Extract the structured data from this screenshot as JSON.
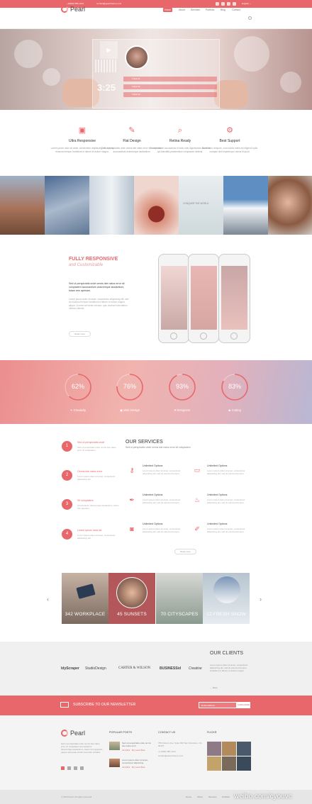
{
  "topbar": {
    "phone": "+1(800) 555-1212",
    "email": "contact@pearl-theme.com",
    "lang": "English ⌄"
  },
  "header": {
    "logo": "Pearl",
    "nav": [
      "Home",
      "About",
      "Services",
      "Portfolio",
      "Blog",
      "Contact"
    ],
    "active": "Home"
  },
  "hero": {
    "time": "3:25",
    "tracks": [
      "Track 01",
      "Track 02",
      "Track 03"
    ]
  },
  "features": [
    {
      "title": "Ultra Responsive",
      "icon": "responsive-icon",
      "text": "Lorem ipsum dolor sit amet, consectetur adipisicing elit, sed do eiusmod tempor incididunt ut labore et dolore magna."
    },
    {
      "title": "Flat Design",
      "icon": "pencil-icon",
      "text": "Sed ut perspiciatis unde omnis iste natus error sit voluptatem accusantium doloremque laudantium."
    },
    {
      "title": "Retina Ready",
      "icon": "magnifier-icon",
      "text": "At vero eos et accusamus et iusto odio dignissimos ducimus qui blanditiis praesentium voluptatum deleniti."
    },
    {
      "title": "Best Support",
      "icon": "gear-icon",
      "text": "Nam libero tempore, cum soluta nobis est eligendi optio cumque nihil impedit quo minus id quod."
    }
  ],
  "strip": {
    "label": "CONQUER THE WORLD"
  },
  "responsive": {
    "title": "FULLY RESPONSIVE",
    "subtitle": "and Customizable",
    "p1": "Sed ut perspiciatis unde omnis iste natus error sit voluptatem accusantium doloremque laudantium, totam rem aperiam.",
    "p2": "Lorem ipsum dolor sit amet, consectetur adipisicing elit, sed do eiusmod tempor incididunt ut labore et dolore magna aliqua. Ut enim ad minim veniam, quis nostrud exercitation ullamco laboris.",
    "button": "Read more"
  },
  "skills": [
    {
      "value": "62%",
      "pct": 62,
      "label": "Creativity",
      "icon": "✦"
    },
    {
      "value": "76%",
      "pct": 76,
      "label": "Web Design",
      "icon": "▣"
    },
    {
      "value": "93%",
      "pct": 93,
      "label": "Designers",
      "icon": "♥"
    },
    {
      "value": "83%",
      "pct": 83,
      "label": "Coding",
      "icon": "◆"
    }
  ],
  "steps": [
    {
      "n": "1",
      "title": "Sed ut perspiciatis unde",
      "text": "Sed ut perspiciatis unde omnis iste natus error sit voluptatem."
    },
    {
      "n": "2",
      "title": "Omnis iste natus error",
      "text": "Lorem ipsum dolor sit amet, consectetur adipisicing elit."
    },
    {
      "n": "3",
      "title": "Sit voluptatem",
      "text": "Accusantium doloremque laudantium, totam rem aperiam."
    },
    {
      "n": "4",
      "title": "Lorem ipsum dolor sit",
      "text": "Lorem ipsum dolor sit amet, consectetur adipisicing elit."
    }
  ],
  "services": {
    "title": "OUR SERVICES",
    "subtitle": "Sed ut perspiciatis unde omnis iste natus error sit voluptatem",
    "items": [
      {
        "title": "Unlimited Options",
        "icon": "key-icon",
        "text": "Lorem ipsum dolor sit amet, consectetur adipisicing elit, sed do eiusmod tempor."
      },
      {
        "title": "Unlimited Options",
        "icon": "browser-icon",
        "text": "Lorem ipsum dolor sit amet, consectetur adipisicing elit, sed do eiusmod tempor."
      },
      {
        "title": "Unlimited Options",
        "icon": "pen-icon",
        "text": "Lorem ipsum dolor sit amet, consectetur adipisicing elit, sed do eiusmod tempor."
      },
      {
        "title": "Unlimited Options",
        "icon": "fire-icon",
        "text": "Lorem ipsum dolor sit amet, consectetur adipisicing elit, sed do eiusmod tempor."
      },
      {
        "title": "Unlimited Options",
        "icon": "camera-icon",
        "text": "Lorem ipsum dolor sit amet, consectetur adipisicing elit, sed do eiusmod tempor."
      },
      {
        "title": "Unlimited Options",
        "icon": "clip-icon",
        "text": "Lorem ipsum dolor sit amet, consectetur adipisicing elit, sed do eiusmod tempor."
      }
    ],
    "button": "Read more"
  },
  "portfolio": [
    {
      "label": "342 WORKPLACE"
    },
    {
      "label": "45 SUNSETS"
    },
    {
      "label": "70 CITYSCAPES"
    },
    {
      "label": "12 FRESH SNOW"
    }
  ],
  "clients": {
    "title": "OUR CLIENTS",
    "text": "Lorem ipsum dolor sit amet, consectetur adipisicing elit, sed do eiusmod tempor incididunt ut labore et dolore magna.",
    "more": "→ More",
    "logos": [
      "IdyScraper",
      "StudioDesign",
      "CARTER & WILSON",
      "BUSINESSid",
      "Creative"
    ]
  },
  "newsletter": {
    "label": "SUBSCRIBE TO OUR NEWSLETTER",
    "placeholder": "Email address",
    "button": "SUBSCRIBE"
  },
  "footer": {
    "logo": "Pearl",
    "about": "Sed ut perspiciatis unde omnis iste natus error sit voluptatem accusantium doloremque laudantium, totam rem aperiam, eaque ipsa quae ab illo inventore veritatis.",
    "popular_title": "POPULAR POSTS",
    "posts": [
      {
        "title": "Sed ut perspiciatis unde omnis iste natus error",
        "meta": "Jul 2014 · By Laura Bow"
      },
      {
        "title": "Lorem ipsum dolor sit amet, consectetur adipisicing",
        "meta": "Jul 2014 · By Laura Bow"
      }
    ],
    "contact_title": "CONTACT US",
    "contact": [
      "795 Folsom Ave, Suite 600 San Francisco, CA 94107",
      "+1 (800) 555-1212",
      "contact@pearl-theme.com"
    ],
    "flickr_title": "FLICKR",
    "copyright": "© 2014 Pearl. All rights reserved.",
    "bottom_nav": [
      "Home",
      "About",
      "Services",
      "Portfolio",
      "Blog"
    ]
  },
  "watermark": "weibo.com/cyouvc"
}
